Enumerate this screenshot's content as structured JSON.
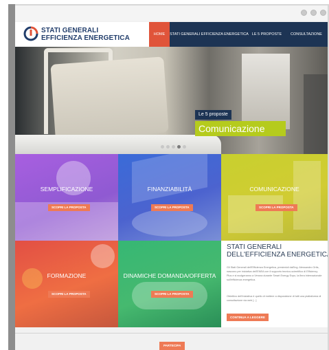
{
  "header": {
    "logo_line1": "STATI GENERALI",
    "logo_line2": "EFFICIENZA ENERGETICA",
    "nav": [
      {
        "label": "HOME",
        "active": true
      },
      {
        "label": "STATI GENERALI EFFICIENZA ENERGETICA",
        "active": false
      },
      {
        "label": "LE 5 PROPOSTE",
        "active": false
      },
      {
        "label": "CONSULTAZIONE",
        "active": false
      }
    ]
  },
  "social_icons": [
    "social-icon",
    "social-icon",
    "social-icon"
  ],
  "hero": {
    "tag": "Le 5 proposte",
    "title": "Comunicazione",
    "slides": 5,
    "active_slide": 3
  },
  "tiles": [
    {
      "label": "SEMPLIFICAZIONE",
      "button": "SCOPRI LA PROPOSTA",
      "color": "#9b5ddb"
    },
    {
      "label": "FINANZIABILITÀ",
      "button": "SCOPRI LA PROPOSTA",
      "color": "#4466d4"
    },
    {
      "label": "COMUNICAZIONE",
      "button": "SCOPRI LA PROPOSTA",
      "color": "#c9cd30"
    },
    {
      "label": "FORMAZIONE",
      "button": "SCOPRI LA PROPOSTA",
      "color": "#e85a43"
    },
    {
      "label": "DINAMICHE DOMANDA/OFFERTA",
      "button": "SCOPRI LA PROPOSTA",
      "color": "#3db672"
    }
  ],
  "about": {
    "title_line1": "STATI GENERALI",
    "title_line2": "DELL'EFFICIENZA ENERGETICA",
    "paragraph1": "Gli Stati Generali dell'Efficienza Energetica, presieduti dall'Ing. Alessandro Ortis, nascono per iniziativa dell'ENEA con il supporto tecnico-scientifico di Efficiency Plus e si svolgeranno a Verona durante Smart Energy Expo, la fiera internazionale sull'efficienza energetica.",
    "paragraph2": "Obiettivo dell'iniziativa è quello di mettere a disposizione di tutti una piattaforma di consultazione via web [...]",
    "button": "CONTINUA A LEGGERE"
  },
  "footer": {
    "button": "PARTECIPA"
  },
  "colors": {
    "navy": "#1d3454",
    "accent": "#e0543a",
    "button": "#ee7a55",
    "lime": "#b5cb1d"
  }
}
